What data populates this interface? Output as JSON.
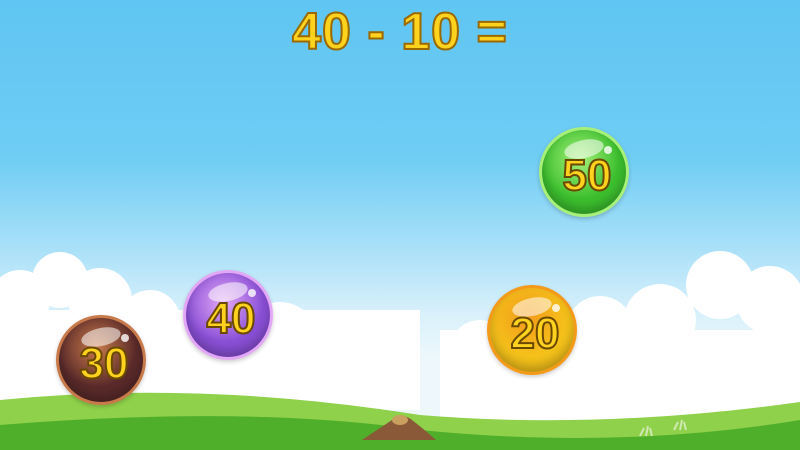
{
  "equation": {
    "text": "40 - 10 ="
  },
  "bubbles": [
    {
      "value": "50",
      "color": "#3cbf2e",
      "rim": "#a6f07a"
    },
    {
      "value": "40",
      "color": "#8a4fd6",
      "rim": "#e3a8f5"
    },
    {
      "value": "30",
      "color": "#5a2a2a",
      "rim": "#c87a4a"
    },
    {
      "value": "20",
      "color": "#f5c21a",
      "rim": "#f39a1a"
    }
  ]
}
